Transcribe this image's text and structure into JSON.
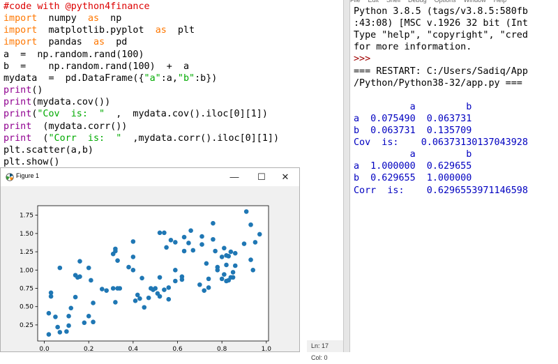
{
  "editor": {
    "lines": [
      [
        {
          "t": "#code with @python4finance",
          "c": "cm"
        }
      ],
      [
        {
          "t": "import",
          "c": "kw"
        },
        {
          "t": "  numpy  ",
          "c": "pl"
        },
        {
          "t": "as",
          "c": "kw"
        },
        {
          "t": "  np",
          "c": "pl"
        }
      ],
      [
        {
          "t": "import",
          "c": "kw"
        },
        {
          "t": "  matplotlib.pyplot  ",
          "c": "pl"
        },
        {
          "t": "as",
          "c": "kw"
        },
        {
          "t": "  plt",
          "c": "pl"
        }
      ],
      [
        {
          "t": "import",
          "c": "kw"
        },
        {
          "t": "  pandas  ",
          "c": "pl"
        },
        {
          "t": "as",
          "c": "kw"
        },
        {
          "t": "  pd",
          "c": "pl"
        }
      ],
      [
        {
          "t": "a  =  np.random.rand(100)",
          "c": "pl"
        }
      ],
      [
        {
          "t": "b  =    np.random.rand(100)  +  a",
          "c": "pl"
        }
      ],
      [
        {
          "t": "mydata  =  pd.DataFrame({",
          "c": "pl"
        },
        {
          "t": "\"a\"",
          "c": "st"
        },
        {
          "t": ":a,",
          "c": "pl"
        },
        {
          "t": "\"b\"",
          "c": "st"
        },
        {
          "t": ":b})",
          "c": "pl"
        }
      ],
      [
        {
          "t": "print",
          "c": "bi"
        },
        {
          "t": "()",
          "c": "pl"
        }
      ],
      [
        {
          "t": "print",
          "c": "bi"
        },
        {
          "t": "(mydata.cov())",
          "c": "pl"
        }
      ],
      [
        {
          "t": "print",
          "c": "bi"
        },
        {
          "t": "(",
          "c": "pl"
        },
        {
          "t": "\"Cov  is:  \"",
          "c": "st"
        },
        {
          "t": "  ,  mydata.cov().iloc[0][1])",
          "c": "pl"
        }
      ],
      [
        {
          "t": "print",
          "c": "bi"
        },
        {
          "t": "  (mydata.corr())",
          "c": "pl"
        }
      ],
      [
        {
          "t": "print",
          "c": "bi"
        },
        {
          "t": "  (",
          "c": "pl"
        },
        {
          "t": "\"Corr  is:  \"",
          "c": "st"
        },
        {
          "t": "  ,mydata.corr().iloc[0][1])",
          "c": "pl"
        }
      ],
      [
        {
          "t": "plt.scatter(a,b)",
          "c": "pl"
        }
      ],
      [
        {
          "t": "plt.show()",
          "c": "pl"
        }
      ]
    ],
    "status_ln": "Ln: 17",
    "status_col": "Col: 0"
  },
  "shell": {
    "menu": [
      "File",
      "Edit",
      "Shell",
      "Debug",
      "Options",
      "Window",
      "Help"
    ],
    "lines": [
      {
        "t": "Python 3.8.5 (tags/v3.8.5:580fb",
        "c": "out"
      },
      {
        "t": ":43:08) [MSC v.1926 32 bit (Int",
        "c": "out"
      },
      {
        "t": "Type \"help\", \"copyright\", \"cred",
        "c": "out"
      },
      {
        "t": "for more information.",
        "c": "out"
      },
      {
        "t": ">>>",
        "c": "prompt"
      },
      {
        "t": "=== RESTART: C:/Users/Sadiq/App",
        "c": "out"
      },
      {
        "t": "/Python/Python38-32/app.py ===",
        "c": "out"
      },
      {
        "t": "",
        "c": "res"
      },
      {
        "t": "          a         b",
        "c": "res"
      },
      {
        "t": "a  0.075490  0.063731",
        "c": "res"
      },
      {
        "t": "b  0.063731  0.135709",
        "c": "res"
      },
      {
        "t": "Cov  is:    0.06373130137043928",
        "c": "res"
      },
      {
        "t": "          a         b",
        "c": "res"
      },
      {
        "t": "a  1.000000  0.629655",
        "c": "res"
      },
      {
        "t": "b  0.629655  1.000000",
        "c": "res"
      },
      {
        "t": "Corr  is:    0.6296553971146598",
        "c": "res"
      }
    ]
  },
  "figure": {
    "title": "Figure 1",
    "minimize": "—",
    "maximize": "☐",
    "close": "✕",
    "icon": "matplotlib-icon"
  },
  "chart_data": {
    "type": "scatter",
    "xlim": [
      -0.03,
      1.01
    ],
    "ylim": [
      0.03,
      1.88
    ],
    "xticks": [
      "0.0",
      "0.2",
      "0.4",
      "0.6",
      "0.8",
      "1.0"
    ],
    "xtick_values": [
      0.0,
      0.2,
      0.4,
      0.6,
      0.8,
      1.0
    ],
    "yticks": [
      "0.25",
      "0.50",
      "0.75",
      "1.00",
      "1.25",
      "1.50",
      "1.75"
    ],
    "ytick_values": [
      0.25,
      0.5,
      0.75,
      1.0,
      1.25,
      1.5,
      1.75
    ],
    "color": "#1f77b4",
    "points": [
      [
        0.02,
        0.41
      ],
      [
        0.02,
        0.12
      ],
      [
        0.03,
        0.64
      ],
      [
        0.03,
        0.69
      ],
      [
        0.05,
        0.36
      ],
      [
        0.06,
        0.22
      ],
      [
        0.07,
        0.15
      ],
      [
        0.07,
        1.03
      ],
      [
        0.1,
        0.16
      ],
      [
        0.11,
        0.37
      ],
      [
        0.11,
        0.24
      ],
      [
        0.12,
        0.48
      ],
      [
        0.14,
        0.63
      ],
      [
        0.14,
        0.93
      ],
      [
        0.15,
        0.9
      ],
      [
        0.16,
        0.91
      ],
      [
        0.16,
        1.12
      ],
      [
        0.18,
        0.28
      ],
      [
        0.2,
        0.37
      ],
      [
        0.2,
        1.03
      ],
      [
        0.21,
        0.86
      ],
      [
        0.22,
        0.55
      ],
      [
        0.22,
        0.29
      ],
      [
        0.26,
        0.74
      ],
      [
        0.28,
        0.72
      ],
      [
        0.31,
        0.75
      ],
      [
        0.31,
        1.22
      ],
      [
        0.32,
        1.29
      ],
      [
        0.32,
        1.26
      ],
      [
        0.32,
        0.56
      ],
      [
        0.33,
        1.13
      ],
      [
        0.33,
        0.75
      ],
      [
        0.34,
        0.75
      ],
      [
        0.38,
        1.04
      ],
      [
        0.4,
        1.0
      ],
      [
        0.4,
        1.18
      ],
      [
        0.4,
        1.39
      ],
      [
        0.41,
        0.58
      ],
      [
        0.42,
        0.66
      ],
      [
        0.43,
        0.61
      ],
      [
        0.44,
        0.89
      ],
      [
        0.45,
        0.49
      ],
      [
        0.47,
        0.62
      ],
      [
        0.48,
        0.75
      ],
      [
        0.49,
        0.73
      ],
      [
        0.5,
        0.75
      ],
      [
        0.51,
        0.68
      ],
      [
        0.52,
        0.64
      ],
      [
        0.52,
        0.9
      ],
      [
        0.52,
        1.51
      ],
      [
        0.54,
        1.51
      ],
      [
        0.54,
        0.73
      ],
      [
        0.55,
        1.31
      ],
      [
        0.56,
        0.6
      ],
      [
        0.56,
        0.76
      ],
      [
        0.57,
        1.41
      ],
      [
        0.59,
        1.38
      ],
      [
        0.59,
        0.85
      ],
      [
        0.59,
        1.0
      ],
      [
        0.62,
        0.91
      ],
      [
        0.62,
        0.87
      ],
      [
        0.63,
        1.26
      ],
      [
        0.63,
        1.45
      ],
      [
        0.65,
        1.37
      ],
      [
        0.66,
        1.54
      ],
      [
        0.67,
        1.27
      ],
      [
        0.7,
        0.8
      ],
      [
        0.71,
        1.46
      ],
      [
        0.71,
        1.35
      ],
      [
        0.72,
        0.72
      ],
      [
        0.73,
        1.09
      ],
      [
        0.74,
        0.76
      ],
      [
        0.74,
        0.88
      ],
      [
        0.76,
        1.42
      ],
      [
        0.76,
        1.64
      ],
      [
        0.77,
        1.26
      ],
      [
        0.78,
        1.04
      ],
      [
        0.78,
        1.0
      ],
      [
        0.8,
        0.88
      ],
      [
        0.8,
        1.18
      ],
      [
        0.81,
        1.3
      ],
      [
        0.81,
        0.94
      ],
      [
        0.82,
        0.85
      ],
      [
        0.82,
        1.07
      ],
      [
        0.82,
        1.2
      ],
      [
        0.83,
        1.19
      ],
      [
        0.83,
        0.86
      ],
      [
        0.84,
        1.25
      ],
      [
        0.84,
        0.9
      ],
      [
        0.85,
        0.97
      ],
      [
        0.85,
        0.9
      ],
      [
        0.86,
        1.23
      ],
      [
        0.86,
        1.06
      ],
      [
        0.9,
        1.36
      ],
      [
        0.91,
        1.8
      ],
      [
        0.93,
        1.14
      ],
      [
        0.93,
        1.62
      ],
      [
        0.94,
        1.0
      ],
      [
        0.95,
        1.38
      ],
      [
        0.97,
        1.49
      ]
    ]
  }
}
